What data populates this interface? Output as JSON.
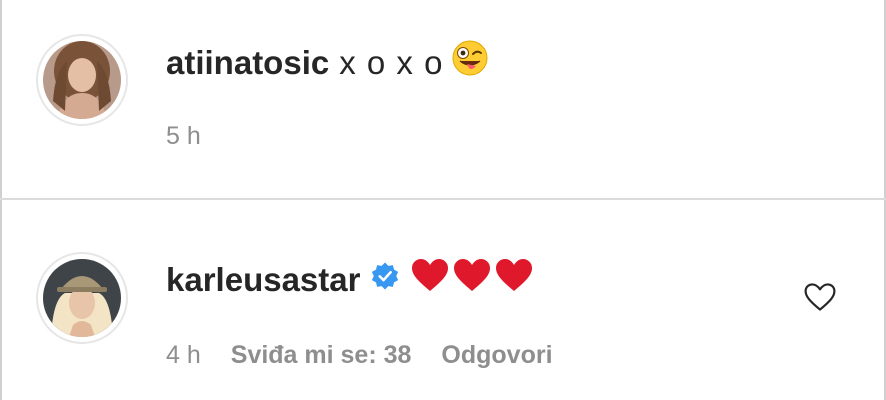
{
  "comments": [
    {
      "username": "atiinatosic",
      "text": "x o x o",
      "emoji": "winking-tongue-emoji",
      "time": "5 h"
    },
    {
      "username": "karleusastar",
      "verified_icon": "verified-badge-icon",
      "hearts": [
        "red-heart-emoji",
        "red-heart-emoji",
        "red-heart-emoji"
      ],
      "time": "4 h",
      "likes": "Sviđa mi se: 38",
      "reply": "Odgovori",
      "like_icon": "heart-outline-icon"
    }
  ],
  "colors": {
    "text": "#262626",
    "meta": "#8e8e8e",
    "verified": "#3897f0",
    "heart": "#e0182c",
    "divider": "#dbdbdb"
  }
}
